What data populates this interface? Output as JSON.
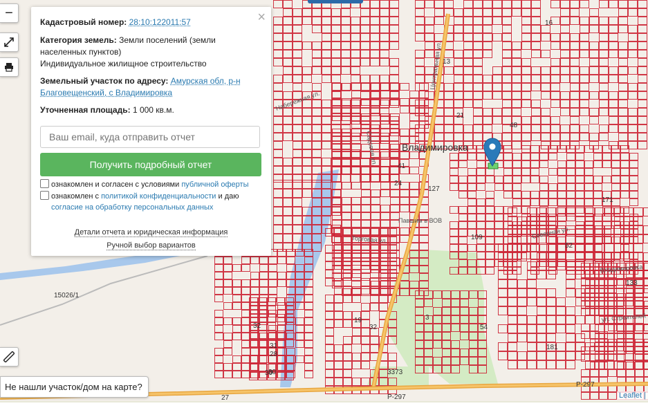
{
  "map": {
    "place_label": "Владимировка",
    "plot_numbers": [
      "16",
      "13",
      "21",
      "48",
      "41",
      "24",
      "127",
      "109",
      "52",
      "54",
      "181",
      "171",
      "133",
      "32",
      "31",
      "28",
      "30",
      "3373",
      "3",
      "19",
      "32",
      "30",
      "15026/1",
      "27",
      "Р-297",
      "Р-297"
    ],
    "street_labels": [
      "Центральная ул.",
      "Торговая ул.",
      "Северная ул.",
      "ул. Строителей",
      "Набережная ул.",
      "Садовая ул.",
      "Владимировка",
      "Павшим в ВОВ"
    ]
  },
  "controls": {
    "zoom_out": "−",
    "fullscreen_icon": "expand-icon",
    "print_icon": "printer-icon",
    "ruler_icon": "ruler-icon"
  },
  "popup": {
    "cadastral_label": "Кадастровый номер:",
    "cadastral_value": "28:10:122011:57",
    "category_label": "Категория земель:",
    "category_value": "Земли поселений (земли населенных пунктов)",
    "usage": "Индивидуальное жилищное строительство",
    "address_label": "Земельный участок по адресу:",
    "address_value": "Амурская обл, р-н Благовещенский, с Владимировка",
    "area_label": "Уточненная площадь:",
    "area_value": "1 000 кв.м.",
    "email_placeholder": "Ваш email, куда отправить отчет",
    "submit_button": "Получить подробный отчет",
    "consent1_pre": "ознакомлен и согласен с условиями ",
    "consent1_link": "публичной оферты",
    "consent2_pre": "ознакомлен с ",
    "consent2_link": "политикой конфиденциальности",
    "consent2_mid": " и даю",
    "consent2_link2": "согласие на обработку персональных данных",
    "details_link": "Детали отчета и юридическая информация",
    "manual_link": "Ручной выбор вариантов",
    "close": "×"
  },
  "not_found": "Не нашли участок/дом на карте?",
  "attribution": {
    "leaflet": "Leaflet",
    "sep": " |"
  },
  "colors": {
    "parcel_line": "#cc2233",
    "button_green": "#5ab55e",
    "marker_blue": "#2a7ab9",
    "water": "#a8c8ec",
    "park": "#d4ebc4"
  }
}
